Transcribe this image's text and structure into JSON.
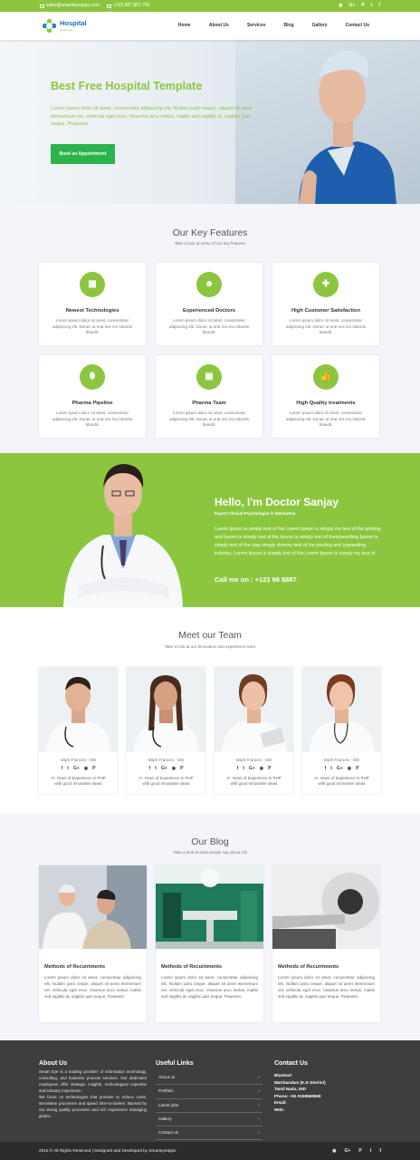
{
  "topbar": {
    "email": "sales@smarteyeapps.com",
    "phone": "+123 987 887 765",
    "social_icons": [
      "github-icon",
      "googleplus-icon",
      "pinterest-icon",
      "twitter-icon",
      "facebook-icon"
    ],
    "social_glyphs": [
      "◉",
      "G+",
      "P",
      "t",
      "f"
    ]
  },
  "nav": {
    "logo_initial": "H",
    "logo_text": "Hospital",
    "logo_tagline": "health care",
    "menu": [
      "Home",
      "About Us",
      "Services",
      "Blog",
      "Gallery",
      "Contact Us"
    ]
  },
  "hero": {
    "title": "Best Free Hospital Template",
    "text": "Lorem ipsum dolor sit amet, consectetur adipiscing elit. Nullam justo neque, aliquet sit amet elementum vel, vehicula eget eros. Vivamus arcu metus, mattis sed sagittis at, sagittis quis neque. Praesent.",
    "button": "Book an Appointment"
  },
  "features": {
    "title": "Our Key Features",
    "subtitle": "Take a look at some of our key features",
    "items": [
      {
        "icon": "building-icon",
        "title": "Newest Technologies",
        "text": "Lorem ipsum dolor sit amet, consectetur adipiscing elit. Donec ut erat nec leo lobortis blandit."
      },
      {
        "icon": "doctor-icon",
        "title": "Experienced Doctors",
        "text": "Lorem ipsum dolor sit amet, consectetur adipiscing elit. Donec ut erat nec leo lobortis blandit."
      },
      {
        "icon": "medkit-icon",
        "title": "High Customer Satisfaction",
        "text": "Lorem ipsum dolor sit amet, consectetur adipiscing elit. Donec ut erat nec leo lobortis blandit."
      },
      {
        "icon": "pills-icon",
        "title": "Pharma Pipeline",
        "text": "Lorem ipsum dolor sit amet, consectetur adipiscing elit. Donec ut erat nec leo lobortis blandit."
      },
      {
        "icon": "medicine-bottle-icon",
        "title": "Pharma Team",
        "text": "Lorem ipsum dolor sit amet, consectetur adipiscing elit. Donec ut erat nec leo lobortis blandit."
      },
      {
        "icon": "thumbs-up-icon",
        "title": "High Quality treatments",
        "text": "Lorem ipsum dolor sit amet, consectetur adipiscing elit. Donec ut erat nec leo lobortis blandit."
      }
    ]
  },
  "profile": {
    "title": "Hello, I'm Doctor Sanjay",
    "subtitle": "Expert Clinical Psychologist in Manhattan",
    "text": "Lorem Ipsum is simply text of the Lorem Ipsum is simply my text of the printing and Ipsum is simply text of the Ipsum is simply text of thetypesetting Ipsum is simply text of the stay simply dummy text of the printing and typesetting industry. Lorem Ipsum is simply text of the Lorem Ipsum is simply my text of",
    "call": "Call me on : +123 98 8887"
  },
  "team": {
    "title": "Meet our Team",
    "subtitle": "Take a look at our Innovative and experience team",
    "members": [
      {
        "name": "Mark Frances - MD",
        "desc1": "3+ Years of Experience In PHP",
        "desc2": "with good Innovative Ideas"
      },
      {
        "name": "Mark Frances - MD",
        "desc1": "3+ Years of Experience In PHP",
        "desc2": "with good Innovative Ideas"
      },
      {
        "name": "Mark Frances - MD",
        "desc1": "3+ Years of Experience In PHP",
        "desc2": "with good Innovative Ideas"
      },
      {
        "name": "Mark Frances - MD",
        "desc1": "3+ Years of Experience In PHP",
        "desc2": "with good Innovative Ideas"
      }
    ],
    "social_glyphs": [
      "f",
      "t",
      "G+",
      "◉",
      "P"
    ]
  },
  "blog": {
    "title": "Our Blog",
    "subtitle": "Take a look at what people say about US",
    "posts": [
      {
        "title": "Methods of Recuirtments",
        "text": "Lorem ipsum dolor sit amet, consectetur adipiscing elit. Nullam justo neque, aliquet sit amet elementum vel, vehicula eget eros. Vivamus arcu metus, mattis sed sagittis at, sagittis quis neque. Praesent."
      },
      {
        "title": "Methods of Recuirtments",
        "text": "Lorem ipsum dolor sit amet, consectetur adipiscing elit. Nullam justo neque, aliquet sit amet elementum vel, vehicula eget eros. Vivamus arcu metus, mattis sed sagittis at, sagittis quis neque. Praesent."
      },
      {
        "title": "Methods of Recuirtments",
        "text": "Lorem ipsum dolor sit amet, consectetur adipiscing elit. Nullam justo neque, aliquet sit amet elementum vel, vehicula eget eros. Vivamus arcu metus, mattis sed sagittis at, sagittis quis neque. Praesent."
      }
    ]
  },
  "footer": {
    "about_title": "About Us",
    "about_text1": "Smart Eye is a leading provider of information technology, consulting, and business process services. Our dedicated employees offer strategic insights, technological expertise and industry experience.",
    "about_text2": "We focus on technologies that promise to reduce costs, streamline processes and speed time-to-market. Backed by our strong quality processes and rich experience managing global...",
    "links_title": "Useful Links",
    "links": [
      "About us",
      "Portfolio",
      "Latest jobs",
      "Gallery",
      "Contact us"
    ],
    "contact_title": "Contact Us",
    "contact_lines": [
      "BlueDart",
      "Marthandam (K.K District)",
      "Tamil Nadu, IND",
      "Phone: +91 9159669599",
      "Email:",
      "Web:"
    ],
    "copyright": "2015 © All Rights Reserved | Designed and Developed by Smarteyeapps",
    "social_glyphs": [
      "◉",
      "G+",
      "P",
      "t",
      "f"
    ]
  },
  "colors": {
    "accent": "#8cc63f",
    "button": "#2cb34a",
    "footer": "#3e3e3e",
    "brand_blue": "#1c6fb0"
  }
}
